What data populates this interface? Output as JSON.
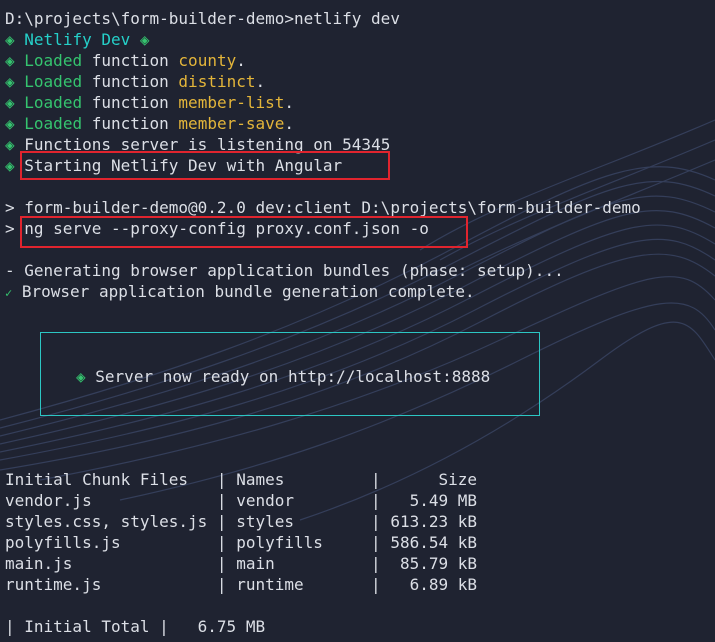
{
  "terminal": {
    "prompt_line": "D:\\projects\\form-builder-demo>netlify dev",
    "netlify_banner": "Netlify Dev",
    "diamond": "◈",
    "loaded_word": "Loaded",
    "function_word": "function",
    "functions": [
      "county",
      "distinct",
      "member-list",
      "member-save"
    ],
    "functions_server": "Functions server is listening on 54345",
    "starting": "Starting Netlify Dev with Angular",
    "run_line": "> form-builder-demo@0.2.0 dev:client D:\\projects\\form-builder-demo",
    "ng_line": "> ng serve --proxy-config proxy.conf.json -o",
    "generating": "- Generating browser application bundles (phase: setup)...",
    "check": "✓",
    "bundle_complete": "Browser application bundle generation complete.",
    "server_ready": "Server now ready on http://localhost:8888"
  },
  "chunk_table": {
    "header": "Initial Chunk Files   | Names         |      Size",
    "rows": [
      "vendor.js             | vendor        |   5.49 MB",
      "styles.css, styles.js | styles        | 613.23 kB",
      "polyfills.js          | polyfills     | 586.54 kB",
      "main.js               | main          |  85.79 kB",
      "runtime.js            | runtime       |   6.89 kB"
    ],
    "total": "| Initial Total |   6.75 MB"
  },
  "colors": {
    "background": "#1f2331",
    "diamond_green": "#35c46f",
    "netlify_teal": "#25d0c9",
    "function_yellow": "#e3b53a",
    "highlight_red": "#e0242e",
    "server_box_cyan": "#2cc6c3"
  }
}
